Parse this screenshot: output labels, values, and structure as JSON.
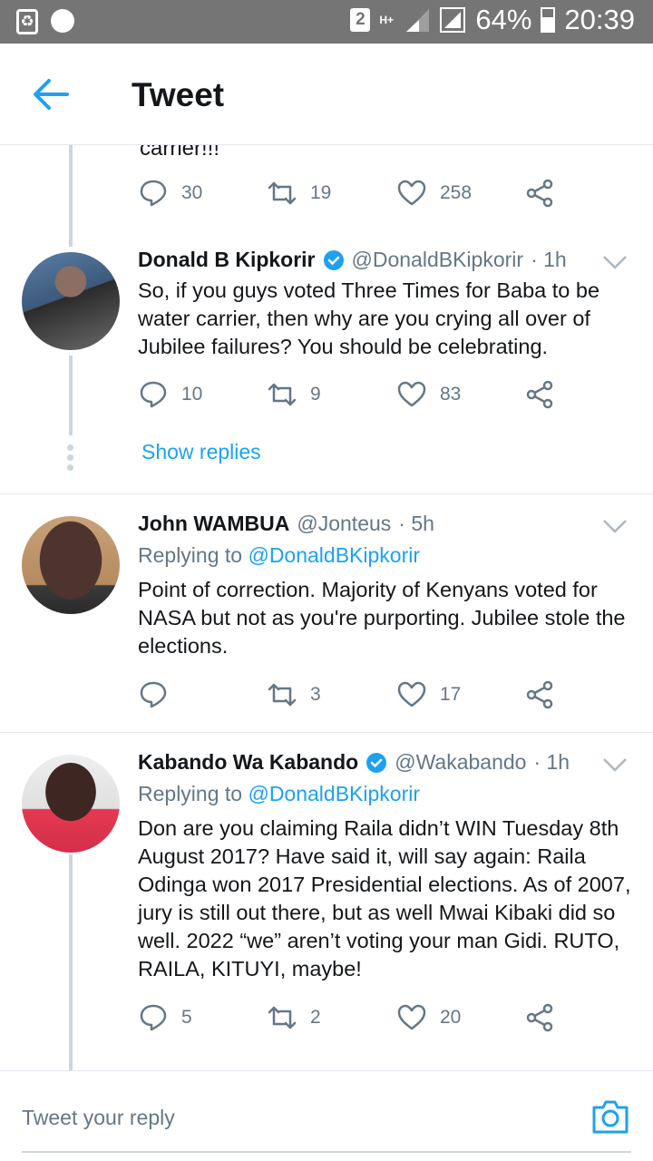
{
  "status_bar": {
    "sim_slot": "2",
    "network": "H+",
    "battery_percent": "64%",
    "time": "20:39"
  },
  "header": {
    "title": "Tweet"
  },
  "previous_tweet": {
    "tail_text": "carrier!!!",
    "replies": "30",
    "retweets": "19",
    "likes": "258"
  },
  "tweets": [
    {
      "name": "Donald B Kipkorir",
      "verified": true,
      "handle": "@DonaldBKipkorir",
      "time": "· 1h",
      "body": "So, if you guys voted Three Times for Baba to be water carrier, then why are you crying all over of Jubilee failures? You should be celebrating.",
      "replies": "10",
      "retweets": "9",
      "likes": "83",
      "show_replies": "Show replies"
    },
    {
      "name": "John WAMBUA",
      "verified": false,
      "handle": "@Jonteus",
      "time": "· 5h",
      "replying_prefix": "Replying to",
      "replying_to": "@DonaldBKipkorir",
      "body": "Point of correction. Majority of Kenyans voted for NASA but not as you're purporting.  Jubilee  stole the elections.",
      "replies": "",
      "retweets": "3",
      "likes": "17"
    },
    {
      "name": "Kabando Wa Kabando",
      "verified": true,
      "handle": "@Wakabando",
      "time": "· 1h",
      "replying_prefix": "Replying to",
      "replying_to": "@DonaldBKipkorir",
      "body": "Don are you claiming Raila didn’t WIN Tuesday 8th August 2017? Have said it, will say again: Raila Odinga won 2017 Presidential elections. As of 2007, jury is still out there, but as well Mwai Kibaki did so well. 2022 “we” aren’t voting your man Gidi. RUTO, RAILA, KITUYI, maybe!",
      "replies": "5",
      "retweets": "2",
      "likes": "20"
    }
  ],
  "compose": {
    "placeholder": "Tweet your reply"
  },
  "colors": {
    "accent": "#1da1f2",
    "secondary_text": "#657786",
    "status_bar": "#757575"
  }
}
